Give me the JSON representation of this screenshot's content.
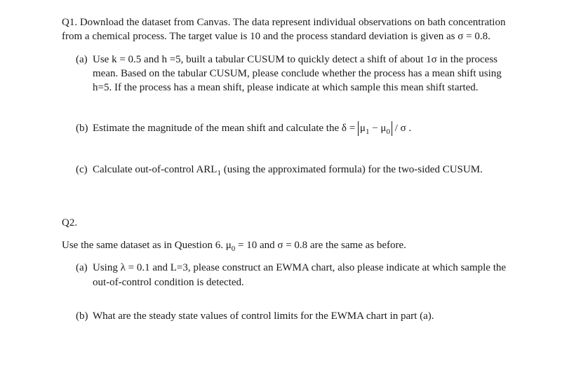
{
  "q1": {
    "intro": "Q1. Download the dataset from Canvas.  The data represent individual observations on bath concentration from a chemical process. The target value is 10 and the process standard deviation is given as σ = 0.8.",
    "a": {
      "marker": "(a)",
      "text": "Use k = 0.5 and h =5, built a tabular CUSUM to quickly detect a shift of about 1σ in the process mean. Based on the tabular CUSUM, please conclude whether the process has a mean shift using h=5.  If the process has a mean shift, please indicate at which sample this mean shift started."
    },
    "b": {
      "marker": "(b)",
      "lead": "Estimate the magnitude of the mean shift and calculate the δ = ",
      "mu1": "μ",
      "sub1": "1",
      "minus": " − ",
      "mu0": "μ",
      "sub0": "0",
      "tail": " / σ ."
    },
    "c": {
      "marker": "(c)",
      "lead": "Calculate out-of-control ARL",
      "sub": "1",
      "tail": " (using the approximated formula) for the two-sided CUSUM."
    }
  },
  "q2": {
    "heading": "Q2.",
    "intro_lead": "Use the same dataset as in Question 6.  μ",
    "intro_sub": "0",
    "intro_tail": " = 10 and σ = 0.8 are the same as before.",
    "a": {
      "marker": "(a)",
      "text": "Using λ = 0.1 and L=3, please construct an EWMA chart, also please indicate at which sample the out-of-control condition is detected."
    },
    "b": {
      "marker": "(b)",
      "text": "What are the steady state values of control limits for the EWMA chart in part (a)."
    }
  }
}
